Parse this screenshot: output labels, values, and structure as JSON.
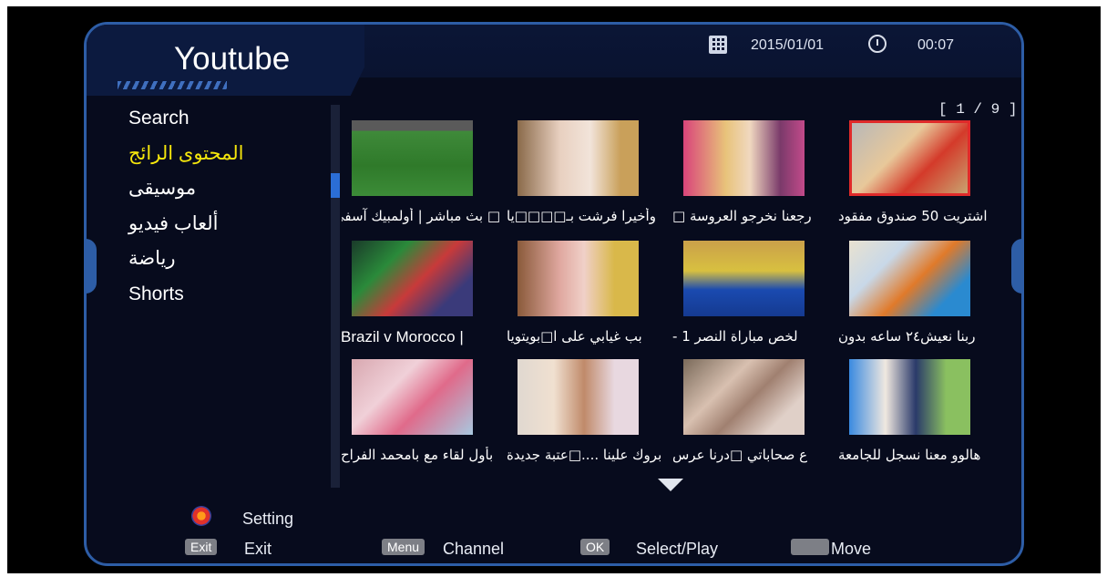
{
  "app_title": "Youtube",
  "header": {
    "date": "2015/01/01",
    "time": "00:07"
  },
  "page_indicator": "[ 1 / 9 ]",
  "menu": {
    "items": [
      {
        "label": "Search"
      },
      {
        "label": "المحتوى الرائج"
      },
      {
        "label": "موسيقى"
      },
      {
        "label": "ألعاب فيديو"
      },
      {
        "label": "رياضة"
      },
      {
        "label": "Shorts"
      }
    ],
    "active_index": 1
  },
  "videos": [
    {
      "title": "اشتريت 50 صندوق مفقود",
      "thumb_icon": "box-store-thumbnail"
    },
    {
      "title": "رجعنا نخرجو العروسة □",
      "thumb_icon": "girls-faces-thumbnail"
    },
    {
      "title": "وأخيرا فرشت بـ□□□□يا",
      "thumb_icon": "girl-room-thumbnail"
    },
    {
      "title": "□ بث مباشر | أولمبيك آسفي",
      "thumb_icon": "football-pitch-thumbnail"
    },
    {
      "title": "ربنا نعيش٢٤ ساعه بدون",
      "thumb_icon": "24h-challenge-thumbnail"
    },
    {
      "title": "لخص مباراة النصر 1 -",
      "thumb_icon": "full-highlights-thumbnail"
    },
    {
      "title": "بب غيابي على ا□بويتويا",
      "thumb_icon": "girl-cartoon-thumbnail"
    },
    {
      "title": "Brazil v Morocco |",
      "thumb_icon": "highlights-thumbnail"
    },
    {
      "title": "هالوو معنا نسجل للجامعة",
      "thumb_icon": "university-thumbnail"
    },
    {
      "title": "ع صحاباتي □درنا عرس",
      "thumb_icon": "wedding-collage-thumbnail"
    },
    {
      "title": "بروك علينا ....□عتبة جديدة",
      "thumb_icon": "family-thumbnail"
    },
    {
      "title": "بأول لقاء مع بامحمد الفراح",
      "thumb_icon": "baby-thumbnail"
    }
  ],
  "legend": {
    "setting": "Setting",
    "exit_key": "Exit",
    "exit": "Exit",
    "menu_key": "Menu",
    "channel": "Channel",
    "ok_key": "OK",
    "select": "Select/Play",
    "move": "Move"
  },
  "colors": {
    "frame_border": "#2d5da6",
    "active_menu": "#f5e60c",
    "selected_border": "#e02a2a",
    "background": "#070b1d"
  }
}
